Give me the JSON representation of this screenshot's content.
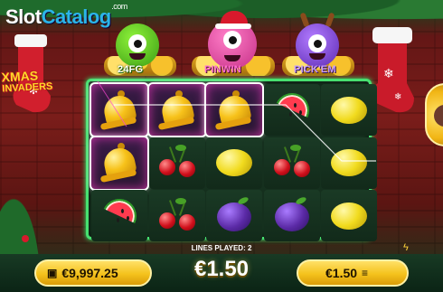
{
  "branding": {
    "logo_part1": "Slot",
    "logo_part2": "Catalog",
    "logo_suffix": ".com",
    "game_title_line1": "XMAS",
    "game_title_line2": "INVADERS"
  },
  "monsters": [
    {
      "name": "24FG",
      "color": "#63cf2b",
      "icon": "green-monster"
    },
    {
      "name": "PINWIN",
      "color": "#ff6fd0",
      "icon": "pink-monster-santa-hat"
    },
    {
      "name": "PICK'EM",
      "color": "#c79bff",
      "icon": "purple-monster-antlers"
    }
  ],
  "reels": {
    "columns": 5,
    "rows": 3,
    "grid": [
      [
        "bell",
        "bell",
        "bell",
        "watermelon",
        "lemon"
      ],
      [
        "bell",
        "cherries",
        "lemon",
        "cherries",
        "lemon"
      ],
      [
        "watermelon",
        "cherries",
        "plum",
        "plum",
        "lemon"
      ]
    ],
    "winning_cells": [
      [
        0,
        0
      ],
      [
        0,
        1
      ],
      [
        0,
        2
      ],
      [
        1,
        0
      ]
    ],
    "frame_color": "#47e070"
  },
  "status": {
    "lines_played_label": "LINES PLAYED: 2"
  },
  "bottom_bar": {
    "balance": "€9,997.25",
    "balance_icon": "wallet-icon",
    "win": "€1.50",
    "bet": "€1.50",
    "bet_icon": "coin-stack-icon"
  }
}
